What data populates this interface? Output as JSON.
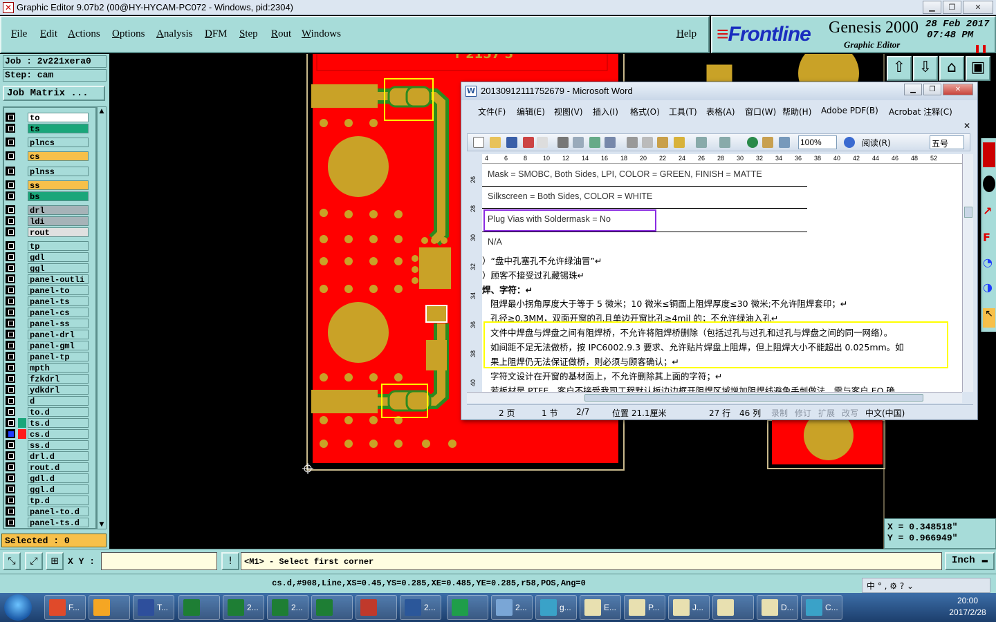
{
  "title_bar": {
    "title": "Graphic Editor 9.07b2 (00@HY-HYCAM-PC072 - Windows, pid:2304)"
  },
  "menu": [
    "File",
    "Edit",
    "Actions",
    "Options",
    "Analysis",
    "DFM",
    "Step",
    "Rout",
    "Windows"
  ],
  "help_label": "Help",
  "logo": {
    "brand": "Frontline",
    "product": "Genesis 2000",
    "subtitle": "Graphic Editor",
    "date": "28 Feb 2017",
    "time": "07:48 PM"
  },
  "job": {
    "job_line": "Job : 2v221xera0",
    "step_line": "Step: cam",
    "matrix_button": "Job Matrix ..."
  },
  "layers": [
    {
      "name": "to",
      "color": "#ffffff",
      "state": "off"
    },
    {
      "name": "ts",
      "color": "#1aa67a",
      "state": "off"
    },
    {
      "name": "plncs",
      "color": "#a7dcd9",
      "state": "off"
    },
    {
      "name": "cs",
      "color": "#f7c04a",
      "state": "off"
    },
    {
      "name": "plnss",
      "color": "#a7dcd9",
      "state": "off"
    },
    {
      "name": "ss",
      "color": "#f7c04a",
      "state": "off"
    },
    {
      "name": "bs",
      "color": "#1aa67a",
      "state": "off"
    },
    {
      "name": "drl",
      "color": "#a6b3b8",
      "state": "off"
    },
    {
      "name": "ldi",
      "color": "#a6b3b8",
      "state": "off"
    },
    {
      "name": "rout",
      "color": "#e0e0e0",
      "state": "off"
    },
    {
      "name": "tp",
      "color": "#a7dcd9",
      "state": "off"
    },
    {
      "name": "gdl",
      "color": "#a7dcd9",
      "state": "off"
    },
    {
      "name": "ggl",
      "color": "#a7dcd9",
      "state": "off"
    },
    {
      "name": "panel-outli",
      "color": "#a7dcd9",
      "state": "off"
    },
    {
      "name": "panel-to",
      "color": "#a7dcd9",
      "state": "off"
    },
    {
      "name": "panel-ts",
      "color": "#a7dcd9",
      "state": "off"
    },
    {
      "name": "panel-cs",
      "color": "#a7dcd9",
      "state": "off"
    },
    {
      "name": "panel-ss",
      "color": "#a7dcd9",
      "state": "off"
    },
    {
      "name": "panel-drl",
      "color": "#a7dcd9",
      "state": "off"
    },
    {
      "name": "panel-gml",
      "color": "#a7dcd9",
      "state": "off"
    },
    {
      "name": "panel-tp",
      "color": "#a7dcd9",
      "state": "off"
    },
    {
      "name": "mpth",
      "color": "#a7dcd9",
      "state": "off"
    },
    {
      "name": "fzkdrl",
      "color": "#a7dcd9",
      "state": "off"
    },
    {
      "name": "ydkdrl",
      "color": "#a7dcd9",
      "state": "off"
    },
    {
      "name": "d",
      "color": "#a7dcd9",
      "state": "off"
    },
    {
      "name": "to.d",
      "color": "#a7dcd9",
      "state": "off"
    },
    {
      "name": "ts.d",
      "color": "#a7dcd9",
      "state": "on-green"
    },
    {
      "name": "cs.d",
      "color": "#a7dcd9",
      "state": "on-red"
    },
    {
      "name": "ss.d",
      "color": "#a7dcd9",
      "state": "off"
    },
    {
      "name": "drl.d",
      "color": "#a7dcd9",
      "state": "off"
    },
    {
      "name": "rout.d",
      "color": "#a7dcd9",
      "state": "off"
    },
    {
      "name": "gdl.d",
      "color": "#a7dcd9",
      "state": "off"
    },
    {
      "name": "ggl.d",
      "color": "#a7dcd9",
      "state": "off"
    },
    {
      "name": "tp.d",
      "color": "#a7dcd9",
      "state": "off"
    },
    {
      "name": "panel-to.d",
      "color": "#a7dcd9",
      "state": "off"
    },
    {
      "name": "panel-ts.d",
      "color": "#a7dcd9",
      "state": "off"
    }
  ],
  "selected_text": "Selected : 0",
  "board_text": "r 2157 5",
  "coordinates": {
    "x": "X = 0.348518\"",
    "y": "Y = 0.966949\""
  },
  "command": {
    "xy_label": "X Y :",
    "xy_value": "",
    "prompt": "<M1> - Select first corner",
    "units": "Inch"
  },
  "info_line": "cs.d,#908,Line,XS=0.45,YS=0.285,XE=0.485,YE=0.285,r58,POS,Ang=0",
  "word": {
    "title": "20130912111752679 - Microsoft Word",
    "menu": [
      "文件(F)",
      "编辑(E)",
      "视图(V)",
      "插入(I)",
      "格式(O)",
      "工具(T)",
      "表格(A)",
      "窗口(W)",
      "帮助(H)",
      "Adobe PDF(B)",
      "Acrobat 注释(C)"
    ],
    "zoom": "100%",
    "read_label": "阅读(R)",
    "font_size": "五号",
    "ruler_ticks": [
      "4",
      "6",
      "8",
      "10",
      "12",
      "14",
      "16",
      "18",
      "20",
      "22",
      "24",
      "26",
      "28",
      "30",
      "32",
      "34",
      "36",
      "38",
      "40",
      "42",
      "44",
      "46",
      "48",
      "52"
    ],
    "vruler_ticks": [
      "26",
      "28",
      "30",
      "32",
      "34",
      "36",
      "38",
      "40"
    ],
    "lines": [
      "Mask = SMOBC, Both Sides, LPI, COLOR = GREEN, FINISH = MATTE",
      "Silkscreen = Both Sides, COLOR = WHITE",
      "Plug Vias with Soldermask = No",
      "N/A",
      "）“盘中孔塞孔不允许绿油冒”↵",
      "）顾客不接受过孔藏锡珠↵",
      "焊、字符：↵",
      "阻焊最小拐角厚度大于等于 5 微米；10 微米≤铜面上阻焊厚度≤30 微米;不允许阻焊套印；↵",
      "孔径≥0.3MM，双面开窗的孔且单边开窗比孔≥4mil 的；不允许绿油入孔↵",
      "文件中焊盘与焊盘之间有阻焊桥，不允许将阻焊桥删除（包括过孔与过孔和过孔与焊盘之间的同一网络）。",
      "如间距不足无法做桥，按 IPC6002.9.3 要求、允许贴片焊盘上阻焊，但上阻焊大小不能超出 0.025mm。如",
      "果上阻焊仍无法保证做桥，则必须与顾客确认；↵",
      "字符文设计在开窗的基材面上，不允许删除其上面的字符；↵",
      "若板材是 PTFE，客户不接受我司工程默认板边边框开阻焊区域增加阻焊线避免手刺做法，需与客户 EQ 确"
    ],
    "status": {
      "page": "2 页",
      "section": "1 节",
      "pages": "2/7",
      "position": "位置 21.1厘米",
      "line": "27 行",
      "column": "46 列",
      "rec": "录制",
      "trk": "修订",
      "ext": "扩展",
      "ovr": "改写",
      "lang": "中文(中国)"
    }
  },
  "taskbar": {
    "items": [
      {
        "label": "F...",
        "color": "#e04a2a"
      },
      {
        "label": "",
        "color": "#f5a623"
      },
      {
        "label": "T...",
        "color": "#2e4f9c"
      },
      {
        "label": "",
        "color": "#1e7e34"
      },
      {
        "label": "2...",
        "color": "#1e7e34"
      },
      {
        "label": "2...",
        "color": "#1e7e34"
      },
      {
        "label": "",
        "color": "#1e7e34"
      },
      {
        "label": "",
        "color": "#c0392b"
      },
      {
        "label": "2...",
        "color": "#2b579a"
      },
      {
        "label": "",
        "color": "#1f9e4a"
      },
      {
        "label": "2...",
        "color": "#7aa6d6"
      },
      {
        "label": "g...",
        "color": "#3aa2c8"
      },
      {
        "label": "E...",
        "color": "#e8e0b0"
      },
      {
        "label": "P...",
        "color": "#e8e0b0"
      },
      {
        "label": "J...",
        "color": "#e8e0b0"
      },
      {
        "label": "",
        "color": "#e8e0b0"
      },
      {
        "label": "D...",
        "color": "#e8e0b0"
      },
      {
        "label": "C...",
        "color": "#3aa2c8"
      }
    ],
    "clock_time": "20:00",
    "clock_date": "2017/2/28"
  },
  "colors": {
    "panel": "#a7dcd9",
    "board_red": "#ff0000",
    "pad_gold": "#c9a227",
    "trace_green": "#2d8a1e",
    "highlight_yellow": "#ffff00",
    "highlight_purple": "#8a2be2"
  }
}
